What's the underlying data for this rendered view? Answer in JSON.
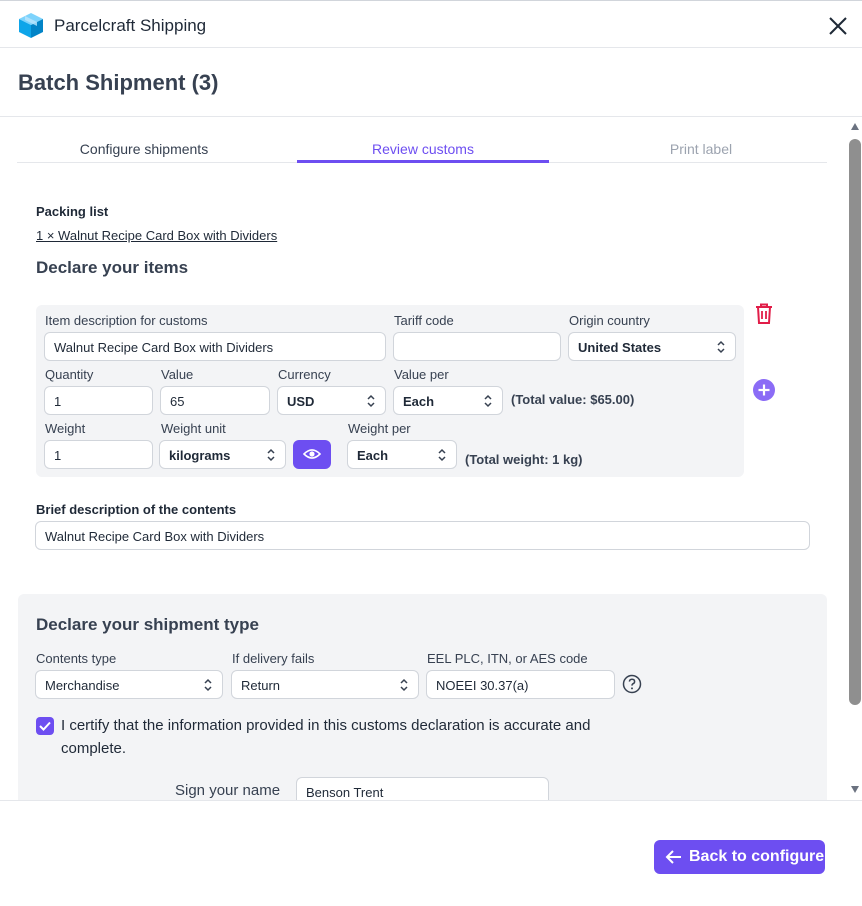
{
  "app": {
    "title": "Parcelcraft Shipping",
    "icon": "box-icon"
  },
  "header": {
    "title": "Batch Shipment (3)"
  },
  "tabs": [
    {
      "label": "Configure shipments",
      "state": "default"
    },
    {
      "label": "Review customs",
      "state": "active"
    },
    {
      "label": "Print label",
      "state": "disabled"
    }
  ],
  "packing": {
    "label": "Packing list",
    "item": "1 × Walnut Recipe Card Box with Dividers"
  },
  "declare_items": {
    "heading": "Declare your items",
    "labels": {
      "description": "Item description for customs",
      "tariff": "Tariff code",
      "origin": "Origin country",
      "quantity": "Quantity",
      "value": "Value",
      "currency": "Currency",
      "value_per": "Value per",
      "weight": "Weight",
      "weight_unit": "Weight unit",
      "weight_per": "Weight per"
    },
    "values": {
      "description": "Walnut Recipe Card Box with Dividers",
      "tariff": "",
      "origin": "United States",
      "quantity": "1",
      "value": "65",
      "currency": "USD",
      "value_per": "Each",
      "weight": "1",
      "weight_unit": "kilograms",
      "weight_per": "Each"
    },
    "total_value": "(Total value: $65.00)",
    "total_weight": "(Total weight: 1 kg)"
  },
  "brief": {
    "label": "Brief description of the contents",
    "value": "Walnut Recipe Card Box with Dividers"
  },
  "shipment_type": {
    "heading": "Declare your shipment type",
    "labels": {
      "contents": "Contents type",
      "delivery_fails": "If delivery fails",
      "eel": "EEL PLC, ITN, or AES code"
    },
    "values": {
      "contents": "Merchandise",
      "delivery_fails": "Return",
      "eel": "NOEEI 30.37(a)"
    },
    "certify_checked": true,
    "certify_text": "I certify that the information provided in this customs declaration is accurate and complete.",
    "sign_label": "Sign your name",
    "sign_value": "Benson Trent"
  },
  "footer": {
    "back_label": "Back to configure"
  },
  "colors": {
    "accent": "#6d4ef1",
    "danger": "#e11d48"
  }
}
